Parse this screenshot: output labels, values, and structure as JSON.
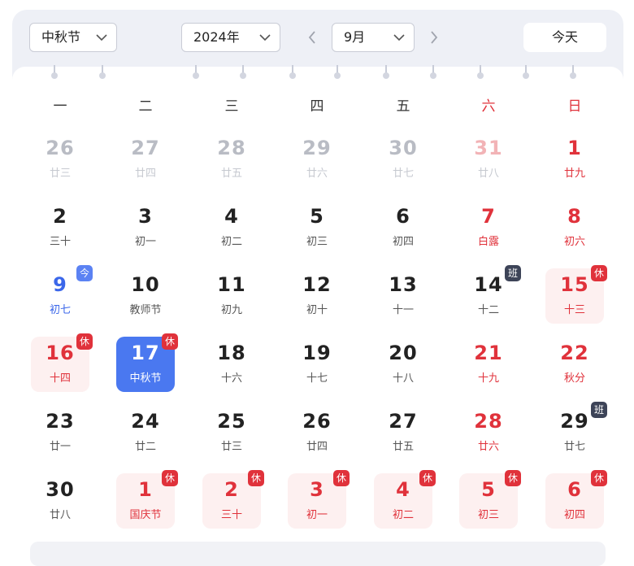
{
  "toolbar": {
    "festival_select": "中秋节",
    "year_select": "2024年",
    "month_select": "9月",
    "today_label": "今天",
    "prev_icon": "chevron-left-icon",
    "next_icon": "chevron-right-icon"
  },
  "weekdays": [
    "一",
    "二",
    "三",
    "四",
    "五",
    "六",
    "日"
  ],
  "colors": {
    "accent": "#4a78f0",
    "holiday_red": "#e0323b",
    "workday_badge": "#3d4458",
    "holiday_bg": "#fdf0f0"
  },
  "weeks": [
    [
      {
        "num": "26",
        "sub": "廿三",
        "other": true
      },
      {
        "num": "27",
        "sub": "廿四",
        "other": true
      },
      {
        "num": "28",
        "sub": "廿五",
        "other": true
      },
      {
        "num": "29",
        "sub": "廿六",
        "other": true
      },
      {
        "num": "30",
        "sub": "廿七",
        "other": true
      },
      {
        "num": "31",
        "sub": "廿八",
        "other": true,
        "red": true
      },
      {
        "num": "1",
        "sub": "廿九",
        "red": true
      }
    ],
    [
      {
        "num": "2",
        "sub": "三十"
      },
      {
        "num": "3",
        "sub": "初一"
      },
      {
        "num": "4",
        "sub": "初二"
      },
      {
        "num": "5",
        "sub": "初三"
      },
      {
        "num": "6",
        "sub": "初四"
      },
      {
        "num": "7",
        "sub": "白露",
        "red": true
      },
      {
        "num": "8",
        "sub": "初六",
        "red": true
      }
    ],
    [
      {
        "num": "9",
        "sub": "初七",
        "today": true,
        "badge": "今",
        "badge_type": "today-b"
      },
      {
        "num": "10",
        "sub": "教师节"
      },
      {
        "num": "11",
        "sub": "初九"
      },
      {
        "num": "12",
        "sub": "初十"
      },
      {
        "num": "13",
        "sub": "十一"
      },
      {
        "num": "14",
        "sub": "十二",
        "badge": "班",
        "badge_type": "work"
      },
      {
        "num": "15",
        "sub": "十三",
        "red": true,
        "holiday": true,
        "badge": "休",
        "badge_type": "rest"
      }
    ],
    [
      {
        "num": "16",
        "sub": "十四",
        "red": true,
        "holiday": true,
        "badge": "休",
        "badge_type": "rest"
      },
      {
        "num": "17",
        "sub": "中秋节",
        "selected": true,
        "badge": "休",
        "badge_type": "rest"
      },
      {
        "num": "18",
        "sub": "十六"
      },
      {
        "num": "19",
        "sub": "十七"
      },
      {
        "num": "20",
        "sub": "十八"
      },
      {
        "num": "21",
        "sub": "十九",
        "red": true
      },
      {
        "num": "22",
        "sub": "秋分",
        "red": true
      }
    ],
    [
      {
        "num": "23",
        "sub": "廿一"
      },
      {
        "num": "24",
        "sub": "廿二"
      },
      {
        "num": "25",
        "sub": "廿三"
      },
      {
        "num": "26",
        "sub": "廿四"
      },
      {
        "num": "27",
        "sub": "廿五"
      },
      {
        "num": "28",
        "sub": "廿六",
        "red": true
      },
      {
        "num": "29",
        "sub": "廿七",
        "badge": "班",
        "badge_type": "work"
      }
    ],
    [
      {
        "num": "30",
        "sub": "廿八"
      },
      {
        "num": "1",
        "sub": "国庆节",
        "red": true,
        "holiday": true,
        "badge": "休",
        "badge_type": "rest"
      },
      {
        "num": "2",
        "sub": "三十",
        "red": true,
        "holiday": true,
        "badge": "休",
        "badge_type": "rest"
      },
      {
        "num": "3",
        "sub": "初一",
        "red": true,
        "holiday": true,
        "badge": "休",
        "badge_type": "rest"
      },
      {
        "num": "4",
        "sub": "初二",
        "red": true,
        "holiday": true,
        "badge": "休",
        "badge_type": "rest"
      },
      {
        "num": "5",
        "sub": "初三",
        "red": true,
        "holiday": true,
        "badge": "休",
        "badge_type": "rest"
      },
      {
        "num": "6",
        "sub": "初四",
        "red": true,
        "holiday": true,
        "badge": "休",
        "badge_type": "rest"
      }
    ]
  ]
}
